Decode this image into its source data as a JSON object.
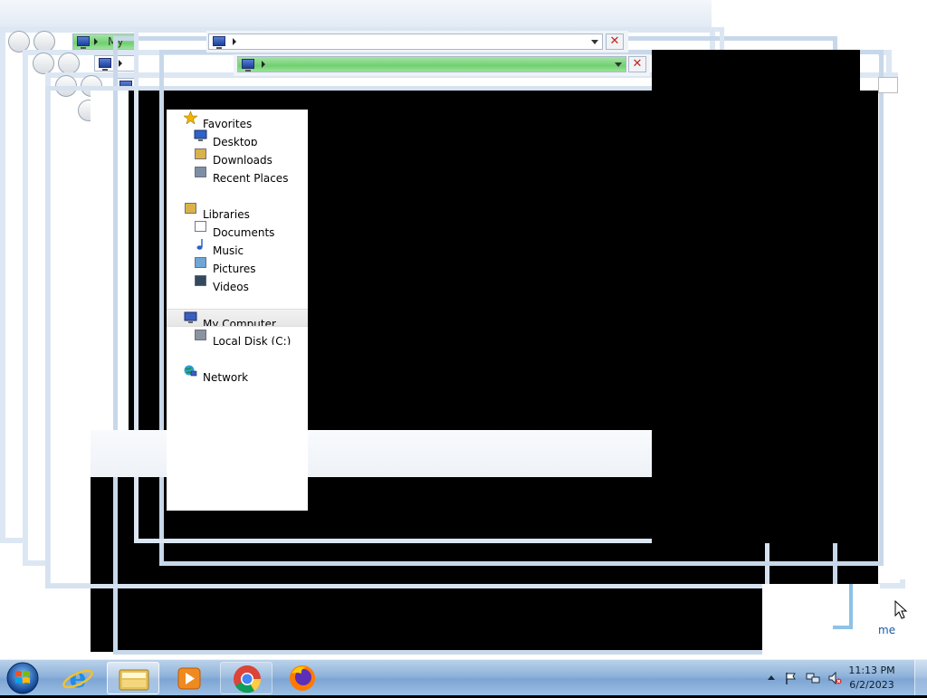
{
  "windows": {
    "back_address_text": "My Co",
    "partial_link_text": "me"
  },
  "nav_pane": {
    "items": [
      {
        "label": "Favorites",
        "icon": "star-icon",
        "level": 0
      },
      {
        "label": "Desktop",
        "icon": "desktop-icon",
        "level": 1
      },
      {
        "label": "Downloads",
        "icon": "downloads-icon",
        "level": 1
      },
      {
        "label": "Recent Places",
        "icon": "recent-places-icon",
        "level": 1
      },
      {
        "label": "Libraries",
        "icon": "libraries-icon",
        "level": 0
      },
      {
        "label": "Documents",
        "icon": "documents-icon",
        "level": 1
      },
      {
        "label": "Music",
        "icon": "music-icon",
        "level": 1
      },
      {
        "label": "Pictures",
        "icon": "pictures-icon",
        "level": 1
      },
      {
        "label": "Videos",
        "icon": "videos-icon",
        "level": 1
      },
      {
        "label": "My Computer",
        "icon": "computer-icon",
        "level": 0
      },
      {
        "label": "Local Disk (C:)",
        "icon": "local-disk-icon",
        "level": 1
      },
      {
        "label": "Network",
        "icon": "network-icon",
        "level": 0
      }
    ]
  },
  "taskbar": {
    "start_icon": "windows-start-icon",
    "pinned": [
      {
        "name": "internet-explorer",
        "icon": "internet-explorer-icon"
      },
      {
        "name": "windows-explorer",
        "icon": "folder-icon",
        "active": true
      },
      {
        "name": "media-player",
        "icon": "media-player-icon"
      },
      {
        "name": "chrome",
        "icon": "chrome-icon"
      },
      {
        "name": "firefox",
        "icon": "firefox-icon"
      }
    ],
    "tray_icons": [
      "show-hidden-icons-icon",
      "action-center-flag-icon",
      "network-icon",
      "volume-muted-icon"
    ],
    "clock": {
      "time": "11:13 PM",
      "date": "6/2/2023"
    }
  },
  "colors": {
    "taskbar": "#8fb3da",
    "address_highlight": "#6fd16f",
    "close_x": "#c0261e"
  }
}
